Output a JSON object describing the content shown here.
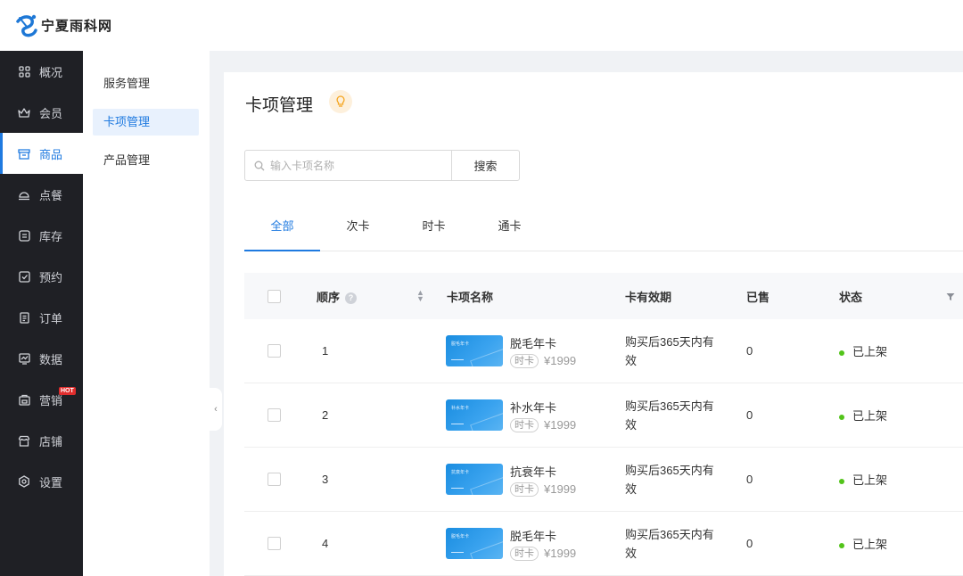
{
  "brand": {
    "name": "宁夏雨科网"
  },
  "sidebar": {
    "items": [
      {
        "label": "概况",
        "icon": "grid-icon"
      },
      {
        "label": "会员",
        "icon": "crown-icon"
      },
      {
        "label": "商品",
        "icon": "store-icon",
        "active": true
      },
      {
        "label": "点餐",
        "icon": "dish-icon"
      },
      {
        "label": "库存",
        "icon": "inventory-icon"
      },
      {
        "label": "预约",
        "icon": "calendar-check-icon"
      },
      {
        "label": "订单",
        "icon": "order-icon"
      },
      {
        "label": "数据",
        "icon": "chart-icon"
      },
      {
        "label": "营销",
        "icon": "marketing-icon",
        "badge": "HOT"
      },
      {
        "label": "店铺",
        "icon": "shop-icon"
      },
      {
        "label": "设置",
        "icon": "settings-icon"
      }
    ]
  },
  "submenu": {
    "items": [
      {
        "label": "服务管理"
      },
      {
        "label": "卡项管理",
        "active": true
      },
      {
        "label": "产品管理"
      }
    ]
  },
  "main": {
    "title": "卡项管理",
    "search": {
      "placeholder": "输入卡项名称",
      "value": "",
      "button": "搜索"
    },
    "tabs": [
      {
        "label": "全部",
        "active": true
      },
      {
        "label": "次卡"
      },
      {
        "label": "时卡"
      },
      {
        "label": "通卡"
      }
    ],
    "table": {
      "headers": {
        "order": "顺序",
        "name": "卡项名称",
        "validity": "卡有效期",
        "sold": "已售",
        "status": "状态"
      },
      "rows": [
        {
          "order": "1",
          "name": "脱毛年卡",
          "thumb_label": "脱毛年卡",
          "tag": "时卡",
          "price": "¥1999",
          "validity": "购买后365天内有效",
          "sold": "0",
          "status": "已上架"
        },
        {
          "order": "2",
          "name": "补水年卡",
          "thumb_label": "补水年卡",
          "tag": "时卡",
          "price": "¥1999",
          "validity": "购买后365天内有效",
          "sold": "0",
          "status": "已上架"
        },
        {
          "order": "3",
          "name": "抗衰年卡",
          "thumb_label": "抗衰年卡",
          "tag": "时卡",
          "price": "¥1999",
          "validity": "购买后365天内有效",
          "sold": "0",
          "status": "已上架"
        },
        {
          "order": "4",
          "name": "脱毛年卡",
          "thumb_label": "脱毛年卡",
          "tag": "时卡",
          "price": "¥1999",
          "validity": "购买后365天内有效",
          "sold": "0",
          "status": "已上架"
        }
      ]
    }
  },
  "colors": {
    "accent": "#1f7ae0",
    "sidebar_bg": "#1f2025",
    "status_ok": "#52c41a",
    "hot": "#e02d2d"
  }
}
